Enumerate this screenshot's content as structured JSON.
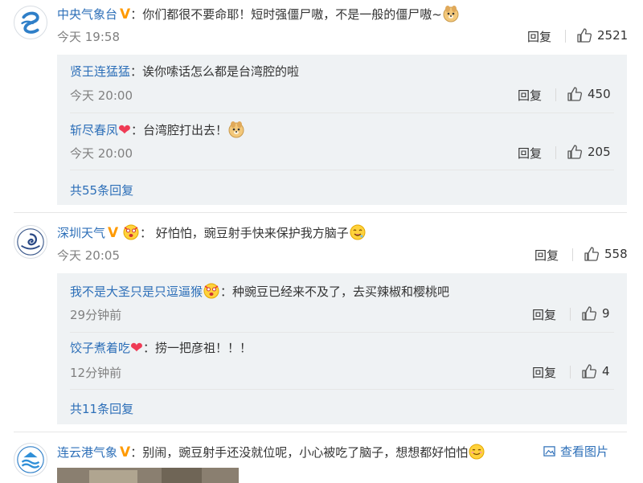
{
  "comments": [
    {
      "user": "中央气象台",
      "text": "你们都很不要命耶！短时强僵尸嗷，不是一般的僵尸嗷~",
      "time": "今天 19:58",
      "reply": "回复",
      "likes": "2521",
      "replies": [
        {
          "user": "贤王连猛猛",
          "text": "诶你嗦话怎么都是台湾腔的啦",
          "time": "今天 20:00",
          "reply": "回复",
          "likes": "450"
        },
        {
          "user": "斩尽春凤",
          "text": "台湾腔打出去！",
          "time": "今天 20:00",
          "reply": "回复",
          "likes": "205"
        }
      ],
      "more": "共55条回复"
    },
    {
      "user": "深圳天气",
      "text": "好怕怕，豌豆射手快来保护我方脑子",
      "time": "今天 20:05",
      "reply": "回复",
      "likes": "558",
      "replies": [
        {
          "user": "我不是大圣只是只逗逼猴",
          "text": "种豌豆已经来不及了，去买辣椒和樱桃吧",
          "time": "29分钟前",
          "reply": "回复",
          "likes": "9"
        },
        {
          "user": "饺子煮着吃",
          "text": "捞一把彦祖！！！",
          "time": "12分钟前",
          "reply": "回复",
          "likes": "4"
        }
      ],
      "more": "共11条回复"
    },
    {
      "user": "连云港气象",
      "text": "别闹，豌豆射手还没就位呢，小心被吃了脑子，想想都好怕怕",
      "view_image": "查看图片"
    }
  ],
  "colors": {
    "link": "#2d6fb8",
    "vbadge": "#ff9a00",
    "heart": "#ef3b55",
    "subbg": "#eff2f4"
  }
}
